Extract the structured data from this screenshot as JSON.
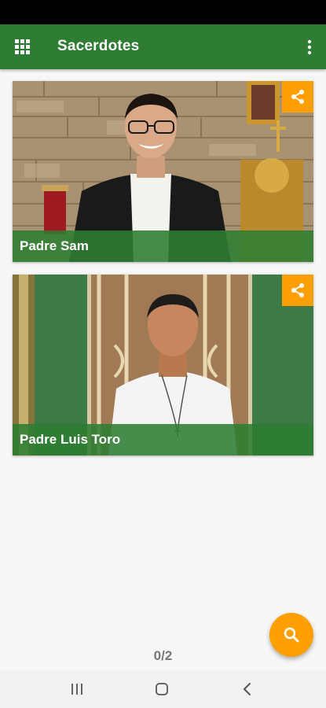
{
  "app_bar": {
    "title": "Sacerdotes",
    "menu_icon": "grid-apps-icon",
    "overflow_icon": "more-vert-icon"
  },
  "cards": [
    {
      "name": "Padre Sam",
      "share_icon": "share-icon"
    },
    {
      "name": "Padre Luis Toro",
      "share_icon": "share-icon"
    }
  ],
  "pager": {
    "text": "0/2"
  },
  "fab": {
    "icon": "search-icon"
  },
  "colors": {
    "primary": "#2e7d32",
    "accent": "#ffa000"
  }
}
